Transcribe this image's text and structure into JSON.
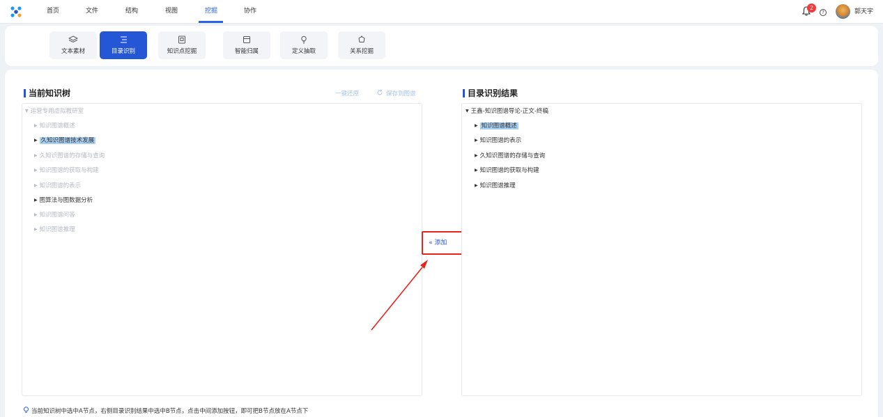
{
  "nav": {
    "items": [
      "首页",
      "文件",
      "结构",
      "视图",
      "挖掘",
      "协作"
    ],
    "active": "挖掘",
    "notification_count": "2",
    "help_symbol": "?",
    "user_name": "郭天宇"
  },
  "toolbar": {
    "buttons": [
      {
        "label": "文本素材",
        "icon": "layers-icon"
      },
      {
        "label": "目录识别",
        "icon": "list-indent-icon",
        "active": true
      },
      {
        "label": "知识点挖掘",
        "icon": "frame-icon"
      },
      {
        "label": "智能归属",
        "icon": "calendar-box-icon"
      },
      {
        "label": "定义抽取",
        "icon": "lightbulb-icon"
      },
      {
        "label": "关系挖掘",
        "icon": "cycle-icon"
      }
    ]
  },
  "left_panel": {
    "title": "当前知识树",
    "restore_label": "一键还原",
    "save_label": "保存到图谱",
    "root": "运营专用虚拟教研室",
    "nodes": [
      {
        "label": "知识图谱概述",
        "style": "muted"
      },
      {
        "label": "久知识图谱技术发展",
        "style": "highlight"
      },
      {
        "label": "久知识图谱的存储与查询",
        "style": "muted"
      },
      {
        "label": "知识图谱的获取与构建",
        "style": "muted"
      },
      {
        "label": "知识图谱的表示",
        "style": "muted"
      },
      {
        "label": "图算法与图数据分析",
        "style": "dark"
      },
      {
        "label": "知识图谱问答",
        "style": "muted"
      },
      {
        "label": "知识图谱推理",
        "style": "muted"
      }
    ]
  },
  "right_panel": {
    "title": "目录识别结果",
    "root": "王鑫-知识图谱导论-正文-终稿",
    "nodes": [
      {
        "label": "知识图谱概述",
        "style": "highlight"
      },
      {
        "label": "知识图谱的表示",
        "style": "dark"
      },
      {
        "label": "久知识图谱的存储与查询",
        "style": "dark"
      },
      {
        "label": "知识图谱的获取与构建",
        "style": "dark"
      },
      {
        "label": "知识图谱推理",
        "style": "dark"
      }
    ]
  },
  "add_button": {
    "label": "添加",
    "icon": "double-chevron-left-icon"
  },
  "hint": "当前知识树中选中A节点，右侧目录识别结果中选中B节点，点击中间添加按钮，即可把B节点放在A节点下",
  "colors": {
    "accent": "#2556d6",
    "annotation": "#e8231c",
    "highlight": "#a8d0f2"
  }
}
